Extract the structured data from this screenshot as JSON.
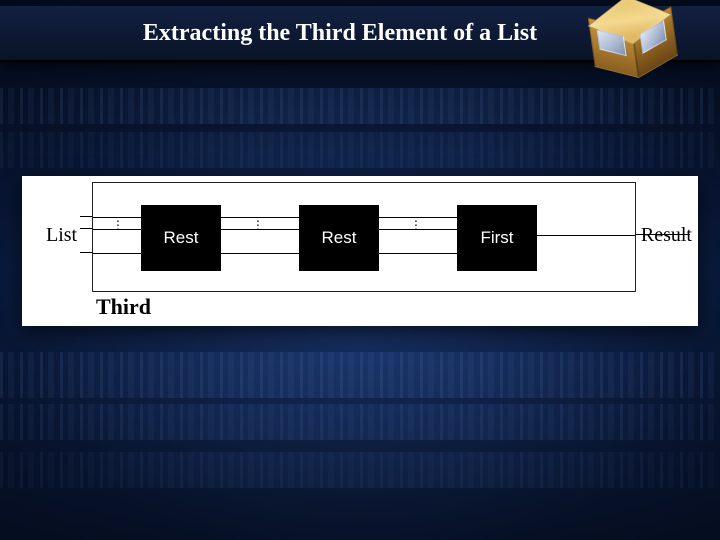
{
  "slide": {
    "title": "Extracting the Third Element of a List"
  },
  "diagram": {
    "caption": "Third",
    "input_label": "List",
    "output_label": "Result",
    "blocks": [
      "Rest",
      "Rest",
      "First"
    ]
  },
  "icons": {
    "cube": "package-cube-icon"
  },
  "colors": {
    "block_bg": "#000000",
    "panel_bg": "#ffffff",
    "accent_gold": "#d9a94d"
  }
}
